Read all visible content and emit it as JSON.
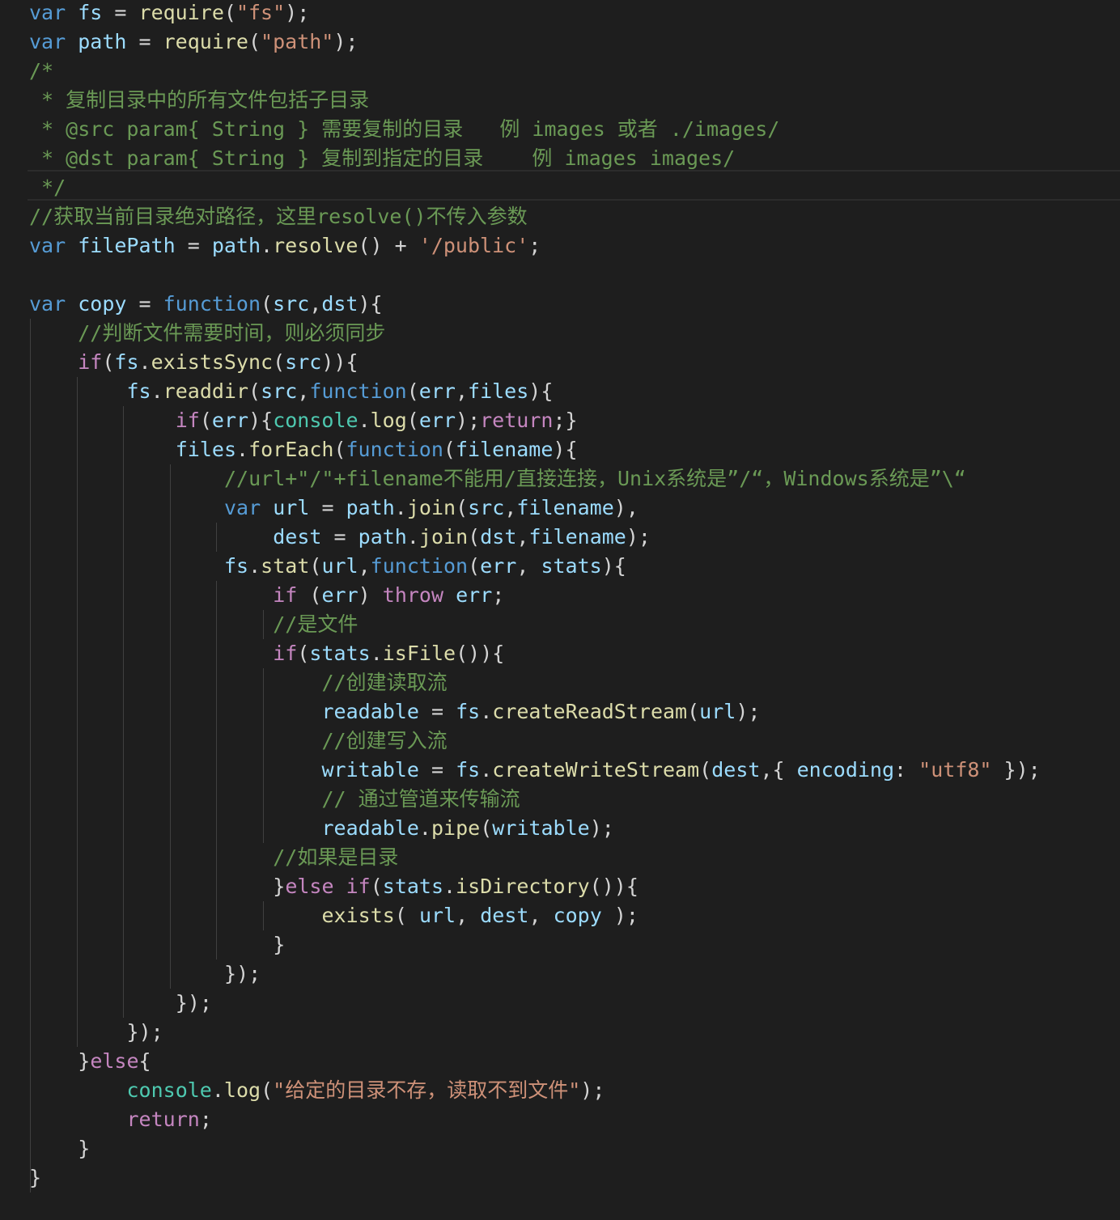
{
  "editor": {
    "background": "#1e1e1e",
    "lines": [
      "var fs = require(\"fs\");",
      "var path = require(\"path\");",
      "/*",
      " * 复制目录中的所有文件包括子目录",
      " * @src param{ String } 需要复制的目录   例 images 或者 ./images/",
      " * @dst param{ String } 复制到指定的目录    例 images images/",
      " */",
      "//获取当前目录绝对路径，这里resolve()不传入参数",
      "var filePath = path.resolve() + '/public';",
      "",
      "var copy = function(src,dst){",
      "    //判断文件需要时间，则必须同步",
      "    if(fs.existsSync(src)){",
      "        fs.readdir(src,function(err,files){",
      "            if(err){console.log(err);return;}",
      "            files.forEach(function(filename){",
      "                //url+\"/\"+filename不能用/直接连接，Unix系统是”/“，Windows系统是”\\“",
      "                var url = path.join(src,filename),",
      "                    dest = path.join(dst,filename);",
      "                fs.stat(url,function(err, stats){",
      "                    if (err) throw err;",
      "                    //是文件",
      "                    if(stats.isFile()){",
      "                        //创建读取流",
      "                        readable = fs.createReadStream(url);",
      "                        //创建写入流",
      "                        writable = fs.createWriteStream(dest,{ encoding: \"utf8\" });",
      "                        // 通过管道来传输流",
      "                        readable.pipe(writable);",
      "                    //如果是目录",
      "                    }else if(stats.isDirectory()){",
      "                        exists( url, dest, copy );",
      "                    }",
      "                });",
      "            });",
      "        });",
      "    }else{",
      "        console.log(\"给定的目录不存，读取不到文件\");",
      "        return;",
      "    }",
      "}"
    ]
  }
}
